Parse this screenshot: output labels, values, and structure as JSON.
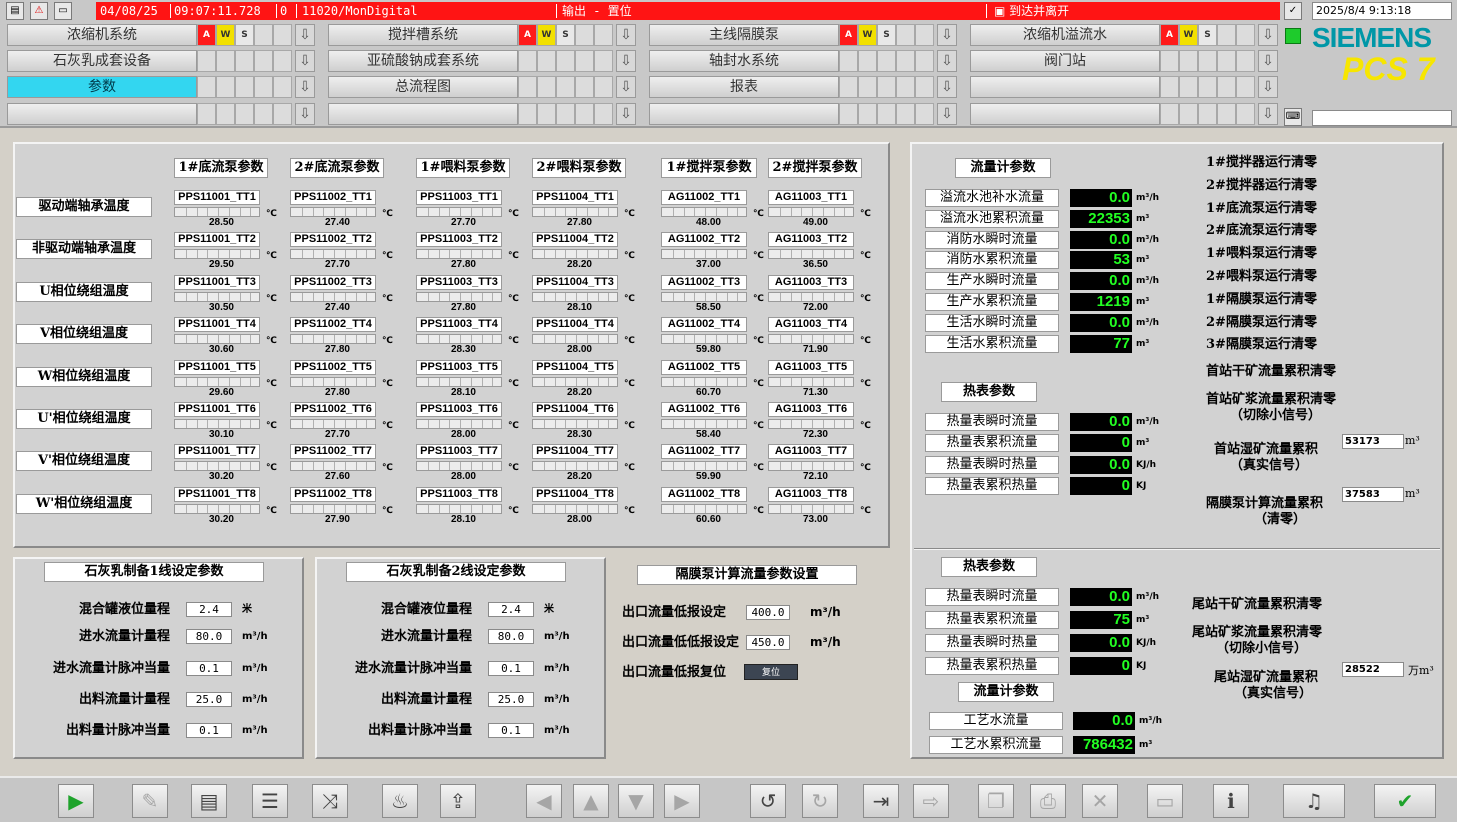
{
  "header": {
    "alarm": {
      "date": "04/08/25",
      "time": "09:07:11.728",
      "count": "0",
      "source": "11020/MonDigital",
      "message": "输出 - 置位",
      "state": "到达并离开"
    },
    "datetime": "2025/8/4 9:13:18",
    "brand": "SIEMENS",
    "product": "PCS 7",
    "aws": [
      "A",
      "W",
      "S"
    ],
    "nav": [
      [
        "浓缩机系统",
        "搅拌槽系统",
        "主线隔膜泵",
        "浓缩机溢流水"
      ],
      [
        "石灰乳成套设备",
        "亚硫酸钠成套系统",
        "轴封水系统",
        "阀门站"
      ],
      [
        "参数",
        "总流程图",
        "报表",
        ""
      ],
      [
        "",
        "",
        "",
        ""
      ]
    ]
  },
  "temps": {
    "columns": [
      "1#底流泵参数",
      "2#底流泵参数",
      "1#喂料泵参数",
      "2#喂料泵参数",
      "1#搅拌泵参数",
      "2#搅拌泵参数"
    ],
    "rows": [
      "驱动端轴承温度",
      "非驱动端轴承温度",
      "U相位绕组温度",
      "V相位绕组温度",
      "W相位绕组温度",
      "U'相位绕组温度",
      "V'相位绕组温度",
      "W'相位绕组温度"
    ],
    "unit": "℃",
    "prefixes": [
      "PPS11001",
      "PPS11002",
      "PPS11003",
      "PPS11004",
      "AG11002",
      "AG11003"
    ],
    "values": [
      [
        "28.50",
        "29.50",
        "30.50",
        "30.60",
        "29.60",
        "30.10",
        "30.20",
        "30.20"
      ],
      [
        "27.40",
        "27.70",
        "27.40",
        "27.80",
        "27.80",
        "27.70",
        "27.60",
        "27.90"
      ],
      [
        "27.70",
        "27.80",
        "27.80",
        "28.30",
        "28.10",
        "28.00",
        "28.00",
        "28.10"
      ],
      [
        "27.80",
        "28.20",
        "28.10",
        "28.00",
        "28.20",
        "28.30",
        "28.20",
        "28.00"
      ],
      [
        "48.00",
        "37.00",
        "58.50",
        "59.80",
        "60.70",
        "58.40",
        "59.90",
        "60.60"
      ],
      [
        "49.00",
        "36.50",
        "72.00",
        "71.90",
        "71.30",
        "72.30",
        "72.10",
        "73.00"
      ]
    ]
  },
  "flow1": {
    "title": "流量计参数",
    "rows": [
      {
        "label": "溢流水池补水流量",
        "value": "0.0",
        "unit": "m³/h"
      },
      {
        "label": "溢流水池累积流量",
        "value": "22353",
        "unit": "m³"
      },
      {
        "label": "消防水瞬时流量",
        "value": "0.0",
        "unit": "m³/h"
      },
      {
        "label": "消防水累积流量",
        "value": "53",
        "unit": "m³"
      },
      {
        "label": "生产水瞬时流量",
        "value": "0.0",
        "unit": "m³/h"
      },
      {
        "label": "生产水累积流量",
        "value": "1219",
        "unit": "m³"
      },
      {
        "label": "生活水瞬时流量",
        "value": "0.0",
        "unit": "m³/h"
      },
      {
        "label": "生活水累积流量",
        "value": "77",
        "unit": "m³"
      }
    ]
  },
  "heat1": {
    "title": "热表参数",
    "rows": [
      {
        "label": "热量表瞬时流量",
        "value": "0.0",
        "unit": "m³/h"
      },
      {
        "label": "热量表累积流量",
        "value": "0",
        "unit": "m³"
      },
      {
        "label": "热量表瞬时热量",
        "value": "0.0",
        "unit": "KJ/h"
      },
      {
        "label": "热量表累积热量",
        "value": "0",
        "unit": "KJ"
      }
    ]
  },
  "resets1": [
    "1#搅拌器运行清零",
    "2#搅拌器运行清零",
    "1#底流泵运行清零",
    "2#底流泵运行清零",
    "1#喂料泵运行清零",
    "2#喂料泵运行清零",
    "1#隔膜泵运行清零",
    "2#隔膜泵运行清零",
    "3#隔膜泵运行清零",
    "首站干矿流量累积清零",
    "首站矿浆流量累积清零",
    "（切除小信号）"
  ],
  "head_wet": {
    "line1": "首站湿矿流量累积",
    "line2": "（真实信号）",
    "value": "53173",
    "unit": "m³"
  },
  "diaphragm_total": {
    "line1": "隔膜泵计算流量累积",
    "line2": "（清零）",
    "value": "37583",
    "unit": "m³"
  },
  "heat2": {
    "title": "热表参数",
    "rows": [
      {
        "label": "热量表瞬时流量",
        "value": "0.0",
        "unit": "m³/h"
      },
      {
        "label": "热量表累积流量",
        "value": "75",
        "unit": "m³"
      },
      {
        "label": "热量表瞬时热量",
        "value": "0.0",
        "unit": "KJ/h"
      },
      {
        "label": "热量表累积热量",
        "value": "0",
        "unit": "KJ"
      }
    ]
  },
  "flow2": {
    "title": "流量计参数",
    "rows": [
      {
        "label": "工艺水流量",
        "value": "0.0",
        "unit": "m³/h"
      },
      {
        "label": "工艺水累积流量",
        "value": "786432",
        "unit": "m³"
      }
    ]
  },
  "resets2": [
    "尾站干矿流量累积清零",
    "尾站矿浆流量累积清零",
    "（切除小信号）"
  ],
  "tail_wet": {
    "line1": "尾站湿矿流量累积",
    "line2": "（真实信号）",
    "value": "28522",
    "unit": "万m³"
  },
  "lime1": {
    "title": "石灰乳制备1线设定参数",
    "rows": [
      {
        "label": "混合罐液位量程",
        "value": "2.4",
        "unit": "米"
      },
      {
        "label": "进水流量计量程",
        "value": "80.0",
        "unit": "m³/h"
      },
      {
        "label": "进水流量计脉冲当量",
        "value": "0.1",
        "unit": "m³/h"
      },
      {
        "label": "出料流量计量程",
        "value": "25.0",
        "unit": "m³/h"
      },
      {
        "label": "出料量计脉冲当量",
        "value": "0.1",
        "unit": "m³/h"
      }
    ]
  },
  "lime2": {
    "title": "石灰乳制备2线设定参数",
    "rows": [
      {
        "label": "混合罐液位量程",
        "value": "2.4",
        "unit": "米"
      },
      {
        "label": "进水流量计量程",
        "value": "80.0",
        "unit": "m³/h"
      },
      {
        "label": "进水流量计脉冲当量",
        "value": "0.1",
        "unit": "m³/h"
      },
      {
        "label": "出料流量计量程",
        "value": "25.0",
        "unit": "m³/h"
      },
      {
        "label": "出料量计脉冲当量",
        "value": "0.1",
        "unit": "m³/h"
      }
    ]
  },
  "membrane": {
    "title": "隔膜泵计算流量参数设置",
    "rows": [
      {
        "label": "出口流量低报设定",
        "value": "400.0",
        "unit": "m³/h"
      },
      {
        "label": "出口流量低低报设定",
        "value": "450.0",
        "unit": "m³/h"
      }
    ],
    "reset_label": "出口流量低报复位",
    "reset_button": "复位"
  },
  "toolbar": [
    "play-icon",
    "wrench-icon",
    "notes-icon",
    "list-icon",
    "trend-icon",
    "thermometer-icon",
    "export-icon",
    "arrow-left-icon",
    "arrow-up-icon",
    "arrow-down-icon",
    "arrow-right-icon",
    "undo-icon",
    "redo-icon",
    "login-icon",
    "logout-icon",
    "copy-icon",
    "print-icon",
    "delete-icon",
    "monitor-icon",
    "info-icon",
    "sound-icon",
    "acknowledge-icon"
  ],
  "colors": {
    "alarm_red": "#ff1414",
    "active_tile": "#33d6f0",
    "value_green": "#22ff22",
    "siemens_teal": "#0097a7",
    "pcs7_yellow": "#f7e600"
  }
}
